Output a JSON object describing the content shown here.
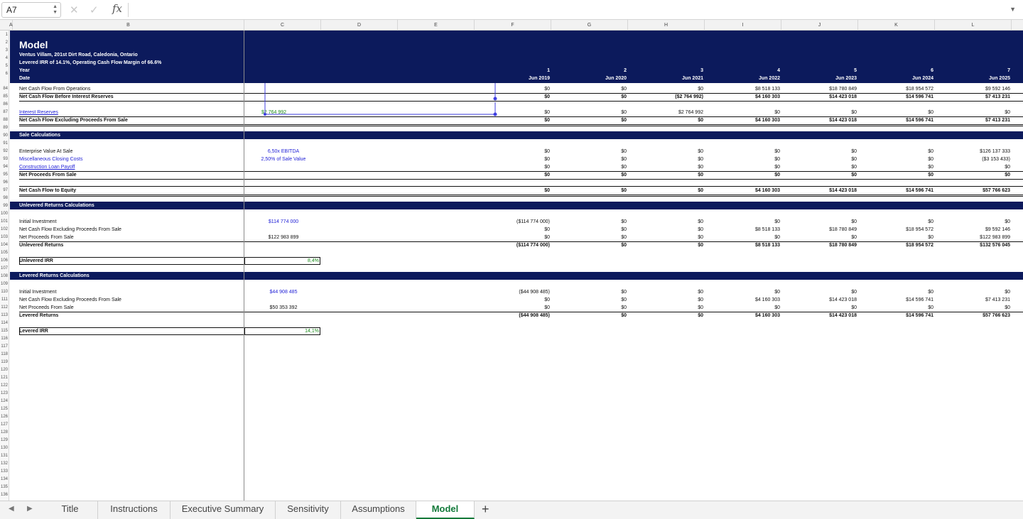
{
  "formula_bar": {
    "name_box": "A7",
    "spinner": "▲▼",
    "cancel": "✕",
    "confirm": "✓",
    "fx": "fx",
    "formula": "",
    "dropdown": "▼"
  },
  "columns": [
    "A",
    "B",
    "C",
    "D",
    "E",
    "F",
    "G",
    "H",
    "I",
    "J",
    "K",
    "L"
  ],
  "rows": [
    "1",
    "2",
    "3",
    "4",
    "5",
    "6",
    "84",
    "85",
    "86",
    "87",
    "88",
    "89",
    "90",
    "91",
    "92",
    "93",
    "94",
    "95",
    "96",
    "97",
    "98",
    "99",
    "100",
    "101",
    "102",
    "103",
    "104",
    "105",
    "106",
    "107",
    "108",
    "109",
    "110",
    "111",
    "112",
    "113",
    "114",
    "115",
    "116",
    "117",
    "118",
    "119",
    "120",
    "121",
    "122",
    "123",
    "124",
    "125",
    "126",
    "127",
    "128",
    "129",
    "130",
    "131",
    "132",
    "133",
    "134",
    "135",
    "136"
  ],
  "header": {
    "title": "Model",
    "subtitle1": "Ventus Villam, 201st Dirt Road, Caledonia, Ontario",
    "subtitle2": "Levered IRR of 14.1%, Operating Cash Flow Margin of 66.6%",
    "year_label": "Year",
    "date_label": "Date",
    "years": [
      "1",
      "2",
      "3",
      "4",
      "5",
      "6",
      "7"
    ],
    "dates": [
      "Jun 2019",
      "Jun 2020",
      "Jun 2021",
      "Jun 2022",
      "Jun 2023",
      "Jun 2024",
      "Jun 2025"
    ]
  },
  "ops": {
    "ncf_ops": {
      "label": "Net Cash Flow From Operations",
      "values": [
        "$0",
        "$0",
        "$0",
        "$8 518 133",
        "$18 780 849",
        "$18 954 572",
        "$9 592 146"
      ]
    },
    "ncf_before": {
      "label": "Net Cash Flow Before Interest Reserves",
      "values": [
        "$0",
        "$0",
        "($2 764 992)",
        "$4 160 303",
        "$14 423 018",
        "$14 596 741",
        "$7 413 231"
      ]
    },
    "interest": {
      "label": "Interest Reserves",
      "input": "$2 764 992",
      "values": [
        "$0",
        "$0",
        "$2 764 992",
        "$0",
        "$0",
        "$0",
        "$0"
      ]
    },
    "ncf_excl": {
      "label": "Net Cash Flow Excluding Proceeds From Sale",
      "values": [
        "$0",
        "$0",
        "$0",
        "$4 160 303",
        "$14 423 018",
        "$14 596 741",
        "$7 413 231"
      ]
    }
  },
  "sale": {
    "title": "Sale Calculations",
    "ev": {
      "label": "Enterprise Value At Sale",
      "input": "6,50x EBITDA",
      "values": [
        "$0",
        "$0",
        "$0",
        "$0",
        "$0",
        "$0",
        "$126 137 333"
      ]
    },
    "misc": {
      "label": "Miscellaneous Closing Costs",
      "input": "2,50% of Sale Value",
      "values": [
        "$0",
        "$0",
        "$0",
        "$0",
        "$0",
        "$0",
        "($3 153 433)"
      ]
    },
    "loan": {
      "label": "Construction Loan Payoff",
      "values": [
        "$0",
        "$0",
        "$0",
        "$0",
        "$0",
        "$0",
        "$0"
      ]
    },
    "net": {
      "label": "Net Proceeds From Sale",
      "values": [
        "$0",
        "$0",
        "$0",
        "$0",
        "$0",
        "$0",
        "$0"
      ]
    },
    "equity": {
      "label": "Net Cash Flow to Equity",
      "values": [
        "$0",
        "$0",
        "$0",
        "$4 160 303",
        "$14 423 018",
        "$14 596 741",
        "$57 766 623"
      ]
    }
  },
  "unlevered": {
    "title": "Unlevered Returns Calculations",
    "invest": {
      "label": "Initial Investment",
      "input": "$114 774 000",
      "values": [
        "($114 774 000)",
        "$0",
        "$0",
        "$0",
        "$0",
        "$0",
        "$0"
      ]
    },
    "ncf": {
      "label": "Net Cash Flow Excluding Proceeds From Sale",
      "values": [
        "$0",
        "$0",
        "$0",
        "$8 518 133",
        "$18 780 849",
        "$18 954 572",
        "$9 592 146"
      ]
    },
    "proceeds": {
      "label": "Net Proceeds From Sale",
      "input": "$122 983 899",
      "values": [
        "$0",
        "$0",
        "$0",
        "$0",
        "$0",
        "$0",
        "$122 983 899"
      ]
    },
    "returns": {
      "label": "Unlevered Returns",
      "values": [
        "($114 774 000)",
        "$0",
        "$0",
        "$8 518 133",
        "$18 780 849",
        "$18 954 572",
        "$132 576 045"
      ]
    },
    "irr_label": "Unlevered IRR",
    "irr": "8,4%"
  },
  "levered": {
    "title": "Levered Returns Calculations",
    "invest": {
      "label": "Initial Investment",
      "input": "$44 908 485",
      "values": [
        "($44 908 485)",
        "$0",
        "$0",
        "$0",
        "$0",
        "$0",
        "$0"
      ]
    },
    "ncf": {
      "label": "Net Cash Flow Excluding Proceeds From Sale",
      "values": [
        "$0",
        "$0",
        "$0",
        "$4 160 303",
        "$14 423 018",
        "$14 596 741",
        "$7 413 231"
      ]
    },
    "proceeds": {
      "label": "Net Proceeds From Sale",
      "input": "$50 353 392",
      "values": [
        "$0",
        "$0",
        "$0",
        "$0",
        "$0",
        "$0",
        "$0"
      ]
    },
    "returns": {
      "label": "Levered Returns",
      "values": [
        "($44 908 485)",
        "$0",
        "$0",
        "$4 160 303",
        "$14 423 018",
        "$14 596 741",
        "$57 766 623"
      ]
    },
    "irr_label": "Levered IRR",
    "irr": "14,1%"
  },
  "tabs": [
    "Title",
    "Instructions",
    "Executive Summary",
    "Sensitivity",
    "Assumptions",
    "Model"
  ],
  "active_tab": "Model",
  "add_sheet": "+",
  "colors": {
    "band": "#0c1a5c",
    "active_tab": "#127a3a",
    "input_blue": "#1f1fd6",
    "irr_green": "#1a8a1a"
  }
}
